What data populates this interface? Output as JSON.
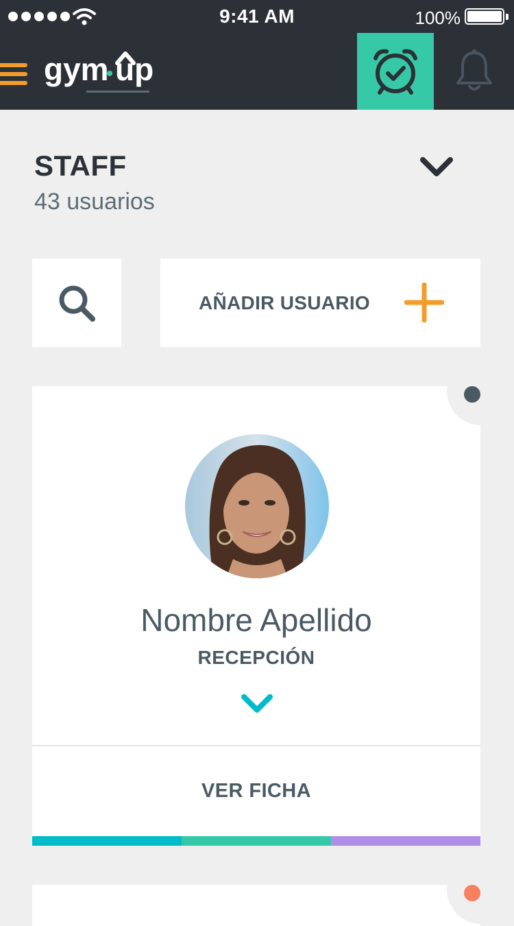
{
  "status_bar": {
    "time": "9:41 AM",
    "battery_percent": "100%"
  },
  "header": {
    "logo_text": "gym·up",
    "icons": [
      "menu-icon",
      "alarm-clock-check-icon",
      "bell-icon"
    ]
  },
  "section": {
    "title": "STAFF",
    "subtitle": "43 usuarios"
  },
  "actions": {
    "add_user_label": "AÑADIR USUARIO"
  },
  "cards": [
    {
      "name": "Nombre Apellido",
      "role": "RECEPCIÓN",
      "view_label": "VER FICHA",
      "status_color": "#4a5a63",
      "bar_colors": [
        "#00bcc9",
        "#36c9a8",
        "#b18ee6"
      ]
    },
    {
      "status_color": "#f7805e"
    }
  ],
  "colors": {
    "header_bg": "#2b3137",
    "accent_green": "#36c9a8",
    "accent_orange": "#f39c2b",
    "chevron_teal": "#00bcc9",
    "text_dark": "#4a5a63"
  }
}
